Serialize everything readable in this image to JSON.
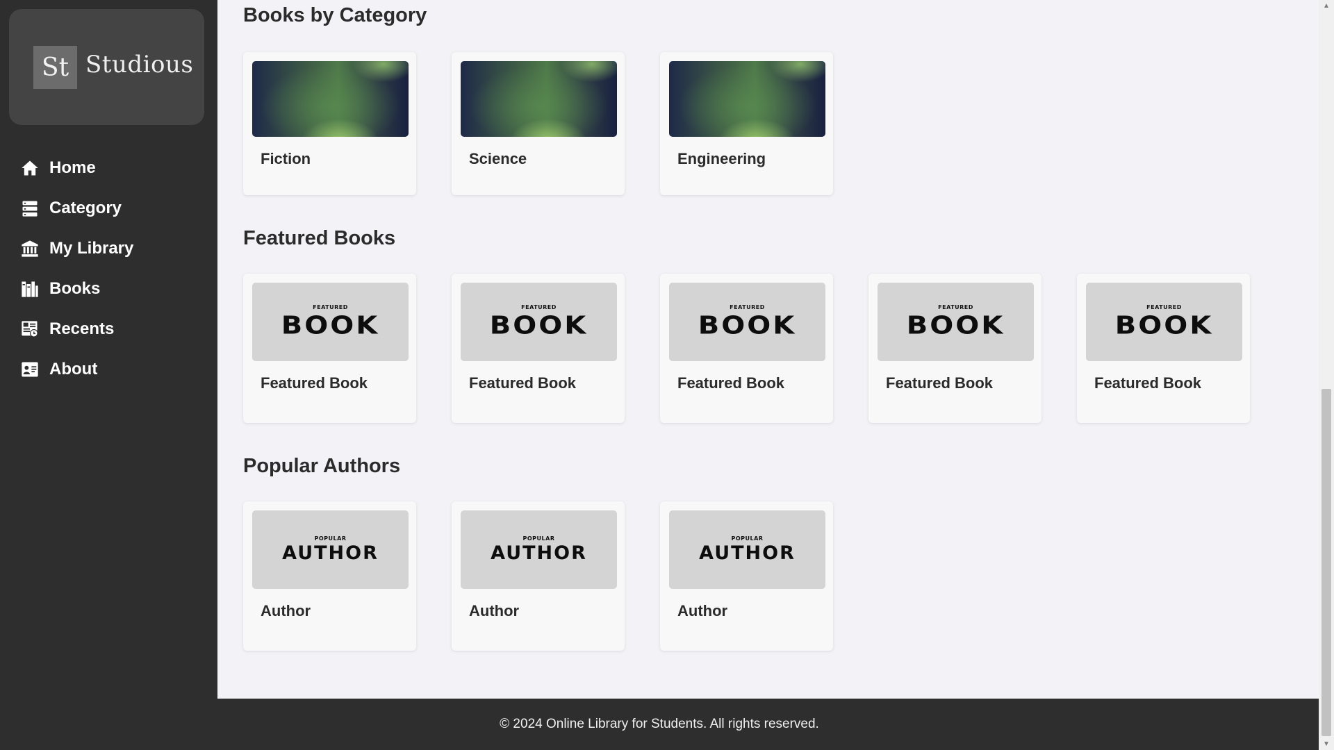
{
  "brand": {
    "mark": "St",
    "name": "Studious"
  },
  "nav": [
    {
      "label": "Home",
      "icon": "home-icon"
    },
    {
      "label": "Category",
      "icon": "category-icon"
    },
    {
      "label": "My Library",
      "icon": "library-icon"
    },
    {
      "label": "Books",
      "icon": "books-icon"
    },
    {
      "label": "Recents",
      "icon": "recents-icon"
    },
    {
      "label": "About",
      "icon": "about-icon"
    }
  ],
  "sections": {
    "categories": {
      "title": "Books by Category",
      "items": [
        {
          "label": "Fiction"
        },
        {
          "label": "Science"
        },
        {
          "label": "Engineering"
        }
      ]
    },
    "featured": {
      "title": "Featured Books",
      "cover_small": "FEATURED",
      "cover_big": "BOOK",
      "items": [
        {
          "label": "Featured Book"
        },
        {
          "label": "Featured Book"
        },
        {
          "label": "Featured Book"
        },
        {
          "label": "Featured Book"
        },
        {
          "label": "Featured Book"
        }
      ]
    },
    "authors": {
      "title": "Popular Authors",
      "cover_small": "POPULAR",
      "cover_big": "AUTHOR",
      "items": [
        {
          "label": "Author"
        },
        {
          "label": "Author"
        },
        {
          "label": "Author"
        }
      ]
    }
  },
  "footer": {
    "text": "© 2024 Online Library for Students. All rights reserved."
  },
  "colors": {
    "sidebar": "#2e2e2e",
    "background": "#f3f2f7",
    "card": "#f8f8f8",
    "cover": "#d4d4d4"
  }
}
